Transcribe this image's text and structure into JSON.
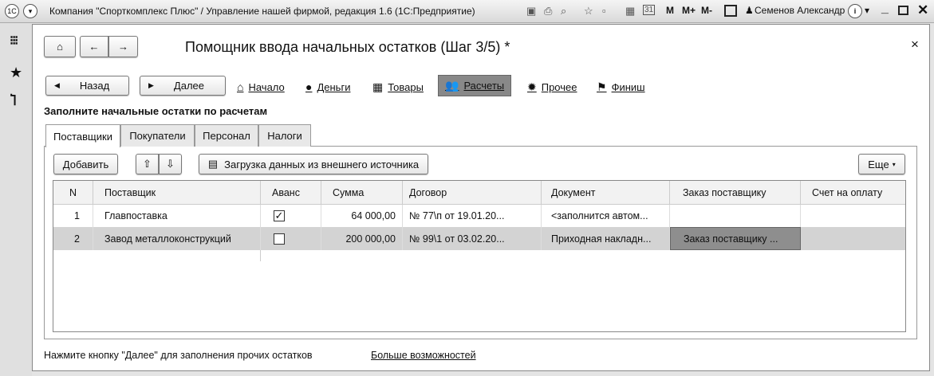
{
  "window": {
    "title": "Компания \"Спорткомплекс Плюс\" / Управление нашей фирмой, редакция 1.6  (1С:Предприятие)",
    "user": "Семенов Александр",
    "m": "M",
    "mplus": "M+",
    "mminus": "M-",
    "calendar": "31",
    "logo": "1С"
  },
  "form": {
    "title": "Помощник ввода начальных остатков (Шаг 3/5) *",
    "close": "×"
  },
  "nav": {
    "back": "Назад",
    "next": "Далее",
    "links": [
      {
        "label": "Начало",
        "icon": "home-icon"
      },
      {
        "label": "Деньги",
        "icon": "ruble-icon"
      },
      {
        "label": "Товары",
        "icon": "cart-icon"
      },
      {
        "label": "Расчеты",
        "icon": "people-icon",
        "active": true
      },
      {
        "label": "Прочее",
        "icon": "gear-icon"
      },
      {
        "label": "Финиш",
        "icon": "flag-icon"
      }
    ]
  },
  "heading": "Заполните начальные остатки по расчетам",
  "tabs": [
    "Поставщики",
    "Покупатели",
    "Персонал",
    "Налоги"
  ],
  "toolbar": {
    "add": "Добавить",
    "load": "Загрузка данных из внешнего источника",
    "more": "Еще"
  },
  "table": {
    "columns": [
      "N",
      "Поставщик",
      "Аванс",
      "Сумма",
      "Договор",
      "Документ",
      "Заказ поставщику",
      "Счет на оплату"
    ],
    "rows": [
      {
        "n": "1",
        "supplier": "Главпоставка",
        "advance": true,
        "sum": "64 000,00",
        "contract": "№ 77\\п от 19.01.20...",
        "document": "<заполнится автом...",
        "order": "",
        "invoice": ""
      },
      {
        "n": "2",
        "supplier": "Завод металлоконструкций",
        "advance": false,
        "sum": "200 000,00",
        "contract": "№ 99\\1 от 03.02.20...",
        "document": "Приходная накладн...",
        "order": "Заказ поставщику ...",
        "invoice": ""
      }
    ]
  },
  "footer": {
    "hint": "Нажмите кнопку \"Далее\" для заполнения прочих остатков",
    "more": "Больше возможностей"
  }
}
